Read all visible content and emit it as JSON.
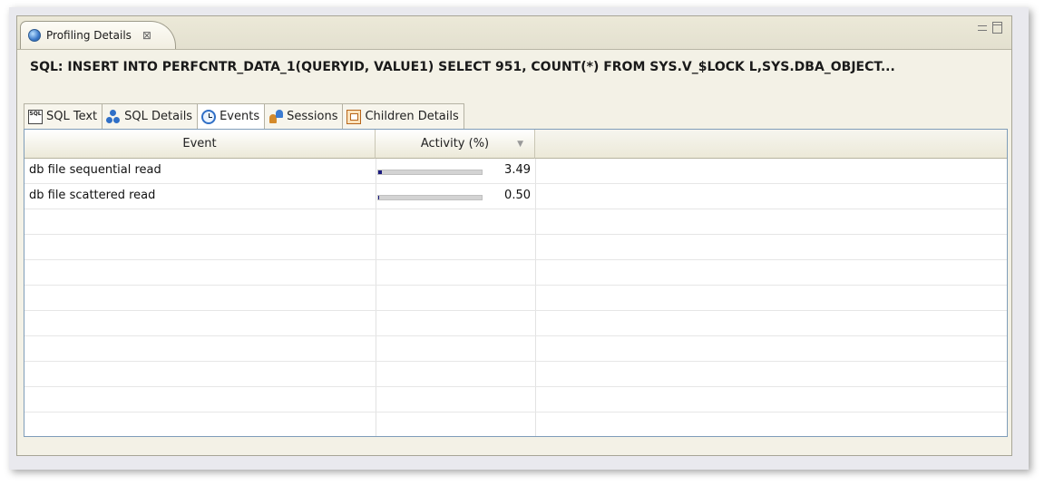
{
  "view": {
    "tab_label": "Profiling Details",
    "close_symbol": "⊠",
    "icons": {
      "tab": "globe-icon",
      "minimize": "minimize-icon",
      "maximize": "maximize-icon"
    }
  },
  "sql_title": "SQL: INSERT INTO PERFCNTR_DATA_1(QUERYID, VALUE1) SELECT 951, COUNT(*) FROM SYS.V_$LOCK L,SYS.DBA_OBJECT...",
  "tabs": [
    {
      "label": "SQL Text",
      "icon": "sql-text-icon"
    },
    {
      "label": "SQL Details",
      "icon": "sql-details-icon"
    },
    {
      "label": "Events",
      "icon": "clock-icon",
      "active": true
    },
    {
      "label": "Sessions",
      "icon": "sessions-icon"
    },
    {
      "label": "Children Details",
      "icon": "children-details-icon"
    }
  ],
  "table": {
    "columns": [
      "Event",
      "Activity (%)"
    ],
    "sort_indicator": "▼",
    "rows": [
      {
        "event": "db file sequential read",
        "value": "3.49",
        "fill_percent": 3.49
      },
      {
        "event": "db file scattered read",
        "value": "0.50",
        "fill_percent": 0.5
      }
    ]
  },
  "colors": {
    "bar_fill": "#1a1a80",
    "bar_track": "#d3d3d3",
    "table_border": "#7f9db9",
    "view_background": "#f3f1e6"
  }
}
